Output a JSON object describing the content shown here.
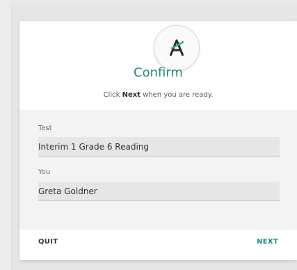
{
  "dialog": {
    "title": "Confirm",
    "instruction_prefix": "Click ",
    "instruction_bold": "Next",
    "instruction_suffix": " when you are ready.",
    "logo_icon": "app-logo-a-icon",
    "accent_color": "#1e8a7f"
  },
  "fields": {
    "test_label": "Test",
    "test_value": "Interim 1 Grade 6 Reading",
    "you_label": "You",
    "you_value": "Greta Goldner"
  },
  "buttons": {
    "quit": "QUIT",
    "next": "NEXT"
  }
}
